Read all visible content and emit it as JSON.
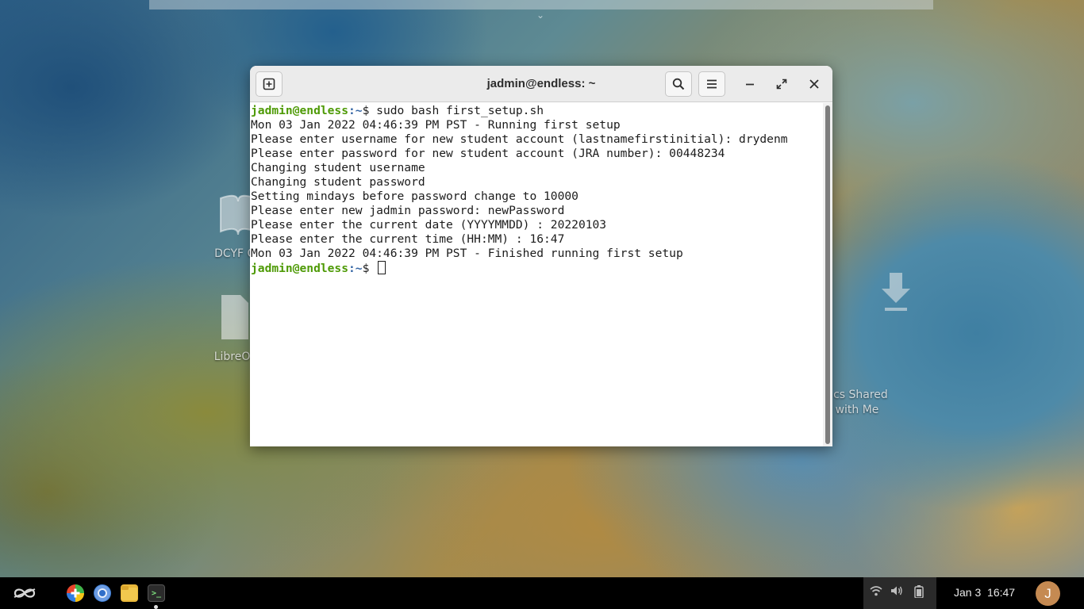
{
  "window": {
    "title": "jadmin@endless: ~"
  },
  "terminal": {
    "lines": [
      {
        "type": "prompt",
        "user": "jadmin@endless",
        "path": ":~",
        "symbol": "$ ",
        "command": "sudo bash first_setup.sh"
      },
      {
        "type": "output",
        "text": "Mon 03 Jan 2022 04:46:39 PM PST - Running first setup"
      },
      {
        "type": "output",
        "text": "Please enter username for new student account (lastnamefirstinitial): drydenm"
      },
      {
        "type": "output",
        "text": "Please enter password for new student account (JRA number): 00448234"
      },
      {
        "type": "output",
        "text": "Changing student username"
      },
      {
        "type": "output",
        "text": "Changing student password"
      },
      {
        "type": "output",
        "text": "Setting mindays before password change to 10000"
      },
      {
        "type": "output",
        "text": "Please enter new jadmin password: newPassword"
      },
      {
        "type": "output",
        "text": "Please enter the current date (YYYYMMDD) : 20220103"
      },
      {
        "type": "output",
        "text": "Please enter the current time (HH:MM) : 16:47"
      },
      {
        "type": "output",
        "text": "Mon 03 Jan 2022 04:46:39 PM PST - Finished running first setup"
      },
      {
        "type": "prompt",
        "user": "jadmin@endless",
        "path": ":~",
        "symbol": "$ ",
        "command": "",
        "cursor": true
      }
    ]
  },
  "desktop": {
    "icons": [
      {
        "label": "DCYF Co",
        "icon": "book-icon"
      },
      {
        "label": "LibreOf",
        "icon": "document-icon"
      },
      {
        "label": "cs Shared\nwith Me",
        "icon": "download-icon"
      }
    ]
  },
  "taskbar": {
    "launcher_icon": "endless-logo-icon",
    "apps": [
      {
        "name": "app-store-icon",
        "color": "#e8452c"
      },
      {
        "name": "chromium-icon",
        "color": "#3f7fd6"
      },
      {
        "name": "files-icon",
        "color": "#e9b73a"
      },
      {
        "name": "terminal-icon",
        "color": "#2b2b2b"
      }
    ],
    "terminal_glyph": ">_",
    "clock": "Jan 3  16:47",
    "avatar_letter": "J"
  }
}
